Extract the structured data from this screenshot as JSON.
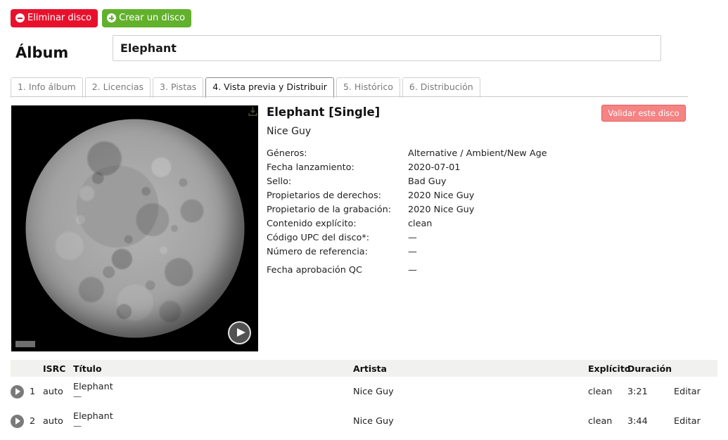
{
  "toolbar": {
    "delete_label": "Eliminar disco",
    "create_label": "Crear un disco",
    "delete_color": "#e8112d",
    "create_color": "#62b12c"
  },
  "album": {
    "label": "Álbum",
    "title_value": "Elephant",
    "title_placeholder": "Elephant"
  },
  "tabs": [
    {
      "label": "1. Info álbum",
      "active": false
    },
    {
      "label": "2. Licencias",
      "active": false
    },
    {
      "label": "3. Pistas",
      "active": false
    },
    {
      "label": "4. Vista previa y Distribuir",
      "active": true
    },
    {
      "label": "5. Histórico",
      "active": false
    },
    {
      "label": "6. Distribución",
      "active": false
    }
  ],
  "release": {
    "title": "Elephant [Single]",
    "artist": "Nice Guy",
    "validate_label": "Validar este disco",
    "validate_color": "#f58383",
    "artwork_alt": "moon-artwork",
    "download_icon": "download-icon",
    "play_icon": "play-icon",
    "meta": [
      {
        "key": "Géneros:",
        "value": "Alternative / Ambient/New Age"
      },
      {
        "key": "Fecha lanzamiento:",
        "value": "2020-07-01"
      },
      {
        "key": "Sello:",
        "value": "Bad Guy"
      },
      {
        "key": "Propietarios de derechos:",
        "value": "2020 Nice Guy"
      },
      {
        "key": "Propietario de la grabación:",
        "value": "2020 Nice Guy"
      },
      {
        "key": "Contenido explícito:",
        "value": "clean"
      },
      {
        "key": "Código UPC del disco*:",
        "value": "—"
      },
      {
        "key": "Número de referencia:",
        "value": "—"
      },
      {
        "key": "Fecha aprobación QC",
        "value": "—"
      }
    ]
  },
  "tracks": {
    "columns": {
      "play": "",
      "num": "",
      "isrc": "ISRC",
      "title": "Título",
      "artist": "Artista",
      "explicit": "Explícito",
      "duration": "Duración",
      "edit": ""
    },
    "rows": [
      {
        "num": "1",
        "isrc": "auto",
        "title": "Elephant",
        "subtitle": "—",
        "artist": "Nice Guy",
        "explicit": "clean",
        "duration": "3:21",
        "edit": "Editar"
      },
      {
        "num": "2",
        "isrc": "auto",
        "title": "Elephant",
        "subtitle": "—",
        "artist": "Nice Guy",
        "explicit": "clean",
        "duration": "3:44",
        "edit": "Editar"
      }
    ]
  }
}
